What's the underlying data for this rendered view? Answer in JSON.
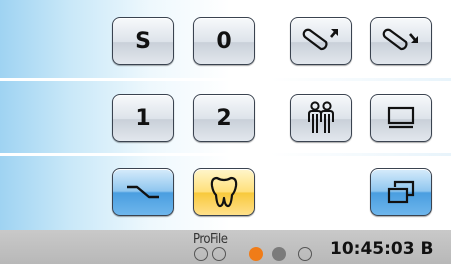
{
  "buttons": {
    "s_label": "S",
    "zero_label": "0",
    "one_label": "1",
    "two_label": "2"
  },
  "icons": {
    "chair_up": "chair-up-icon",
    "chair_down": "chair-down-icon",
    "patient": "patient-icon",
    "screen": "monitor-icon",
    "curve": "curve-icon",
    "tooth": "tooth-icon",
    "windows": "windows-icon"
  },
  "colors": {
    "active_dot": "#f07c18",
    "blue_button": "#4a9ee0",
    "yellow_button": "#f8c93c"
  },
  "status": {
    "profile": "ProFile",
    "time": "10:45:03",
    "time_suffix": "B",
    "page_count": 5,
    "active_page": 3
  }
}
